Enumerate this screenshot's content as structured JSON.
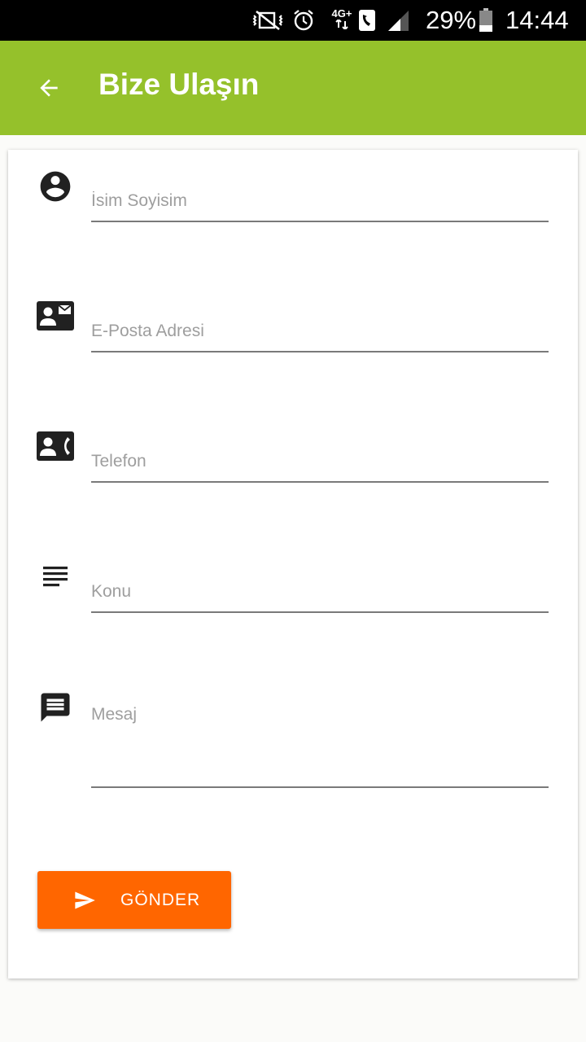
{
  "status_bar": {
    "battery": "29%",
    "time": "14:44",
    "network_label": "4G+",
    "icons": [
      "mute-vibrate-icon",
      "alarm-icon",
      "network-4g-icon",
      "call-icon",
      "signal-icon",
      "battery-icon"
    ]
  },
  "app_bar": {
    "title": "Bize Ulaşın",
    "back_icon": "arrow-back-icon",
    "color": "#95c12b"
  },
  "form": {
    "fields": [
      {
        "placeholder": "İsim Soyisim",
        "icon": "account-circle-icon",
        "value": ""
      },
      {
        "placeholder": "E-Posta Adresi",
        "icon": "contact-mail-icon",
        "value": ""
      },
      {
        "placeholder": "Telefon",
        "icon": "contact-phone-icon",
        "value": ""
      },
      {
        "placeholder": "Konu",
        "icon": "subject-icon",
        "value": ""
      },
      {
        "placeholder": "Mesaj",
        "icon": "message-icon",
        "value": ""
      }
    ],
    "submit": {
      "label": "GÖNDER",
      "icon": "send-icon",
      "color": "#ff6600"
    }
  },
  "colors": {
    "status_bar": "#000000",
    "underline": "#7a7a7a",
    "placeholder": "#9e9e9e",
    "icon": "#212121"
  }
}
